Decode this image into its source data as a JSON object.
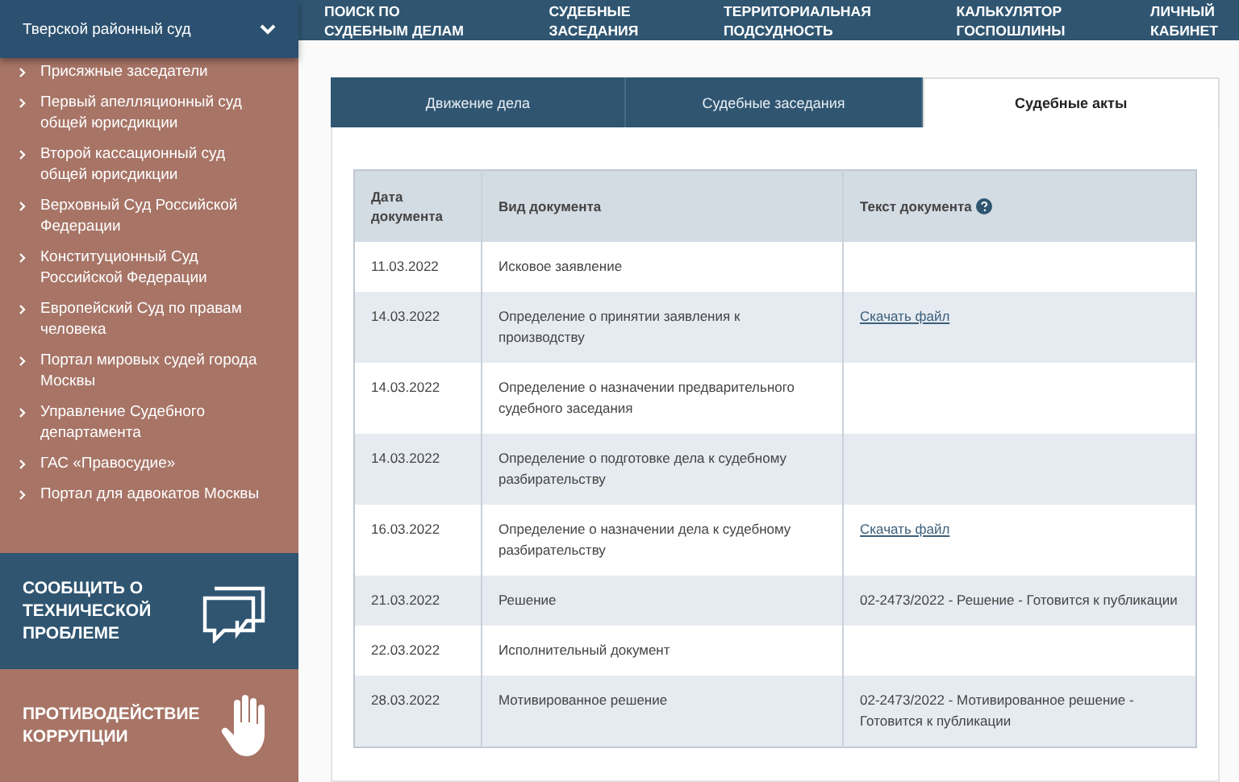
{
  "court_selector": {
    "label": "Тверской районный суд"
  },
  "top_nav": [
    "ПОИСК ПО\nСУДЕБНЫМ ДЕЛАМ",
    "СУДЕБНЫЕ\nЗАСЕДАНИЯ",
    "ТЕРРИТОРИАЛЬНАЯ\nПОДСУДНОСТЬ",
    "КАЛЬКУЛЯТОР\nГОСПОШЛИНЫ",
    "ЛИЧНЫЙ\nКАБИНЕТ"
  ],
  "sidebar": {
    "items": [
      "Присяжные заседатели",
      "Первый апелляционный суд общей юрисдикции",
      "Второй кассационный суд общей юрисдикции",
      "Верховный Суд Российской Федерации",
      "Конституционный Суд Российской Федерации",
      "Европейский Суд по правам человека",
      "Портал мировых судей города Москвы",
      "Управление Судебного департамента",
      "ГАС «Правосудие»",
      "Портал для адвокатов Москвы"
    ],
    "banners": [
      {
        "kind": "report",
        "label": "СООБЩИТЬ О\nТЕХНИЧЕСКОЙ\nПРОБЛЕМЕ"
      },
      {
        "kind": "anticorruption",
        "label": "ПРОТИВОДЕЙСТВИЕ\nКОРРУПЦИИ"
      }
    ]
  },
  "tabs": [
    {
      "label": "Движение дела",
      "selected": false
    },
    {
      "label": "Судебные заседания",
      "selected": false
    },
    {
      "label": "Судебные акты",
      "selected": true
    }
  ],
  "table": {
    "columns": [
      "Дата\nдокумента",
      "Вид документа",
      "Текст документа"
    ],
    "rows": [
      {
        "date": "11.03.2022",
        "type": "Исковое заявление"
      },
      {
        "date": "14.03.2022",
        "type": "Определение о принятии заявления к производству",
        "text": {
          "kind": "link",
          "value": "Скачать файл"
        }
      },
      {
        "date": "14.03.2022",
        "type": "Определение о назначении предварительного судебного заседания"
      },
      {
        "date": "14.03.2022",
        "type": "Определение о подготовке дела к судебному разбирательству"
      },
      {
        "date": "16.03.2022",
        "type": "Определение о назначении дела к судебному разбирательству",
        "text": {
          "kind": "link",
          "value": "Скачать файл"
        }
      },
      {
        "date": "21.03.2022",
        "type": "Решение",
        "text": {
          "kind": "text",
          "value": "02-2473/2022 - Решение - Готовится к публикации"
        }
      },
      {
        "date": "22.03.2022",
        "type": "Исполнительный документ"
      },
      {
        "date": "28.03.2022",
        "type": "Мотивированное решение",
        "text": {
          "kind": "text",
          "value": "02-2473/2022 - Мотивированное решение - Готовится к публикации"
        }
      }
    ]
  }
}
